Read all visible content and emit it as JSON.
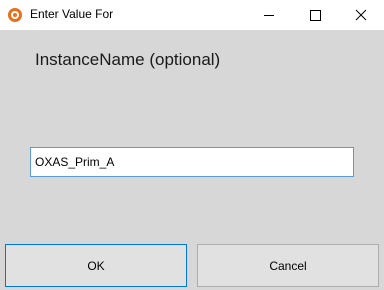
{
  "window": {
    "title": "Enter Value For",
    "app_icon": "orange-target-icon"
  },
  "titlebar_buttons": {
    "minimize_icon": "minimize-icon",
    "maximize_icon": "maximize-icon",
    "close_icon": "close-icon"
  },
  "dialog": {
    "prompt": "InstanceName (optional)",
    "input_value": "OXAS_Prim_A",
    "ok_label": "OK",
    "cancel_label": "Cancel"
  },
  "colors": {
    "background": "#d7d7d7",
    "titlebar": "#ffffff",
    "focus_border": "#0078d7",
    "input_border": "#5a9bd6",
    "app_icon": "#e8701a"
  }
}
